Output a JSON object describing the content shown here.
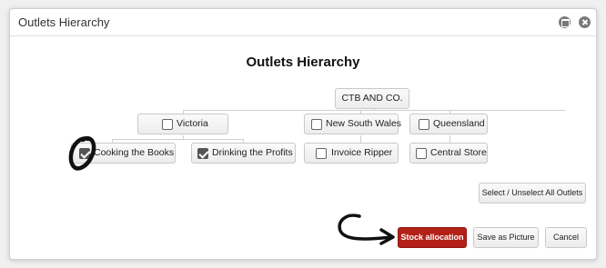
{
  "window": {
    "title": "Outlets Hierarchy"
  },
  "heading": "Outlets Hierarchy",
  "root": {
    "label": "CTB AND CO."
  },
  "regions": [
    {
      "label": "Victoria",
      "checked": false
    },
    {
      "label": "New South Wales",
      "checked": false
    },
    {
      "label": "Queensland",
      "checked": false
    }
  ],
  "outlets": [
    {
      "label": "Cooking the Books",
      "checked": true
    },
    {
      "label": "Drinking the Profits",
      "checked": true
    },
    {
      "label": "Invoice Ripper",
      "checked": false
    },
    {
      "label": "Central Store",
      "checked": false
    }
  ],
  "buttons": {
    "select_all": "Select / Unselect All Outlets",
    "stock_allocation": "Stock allocation",
    "save_picture": "Save as Picture",
    "cancel": "Cancel"
  },
  "icons": {
    "minimize": "minimize-icon",
    "close": "close-icon"
  },
  "colors": {
    "primary_button": "#b22017",
    "annotation": "#111111"
  }
}
